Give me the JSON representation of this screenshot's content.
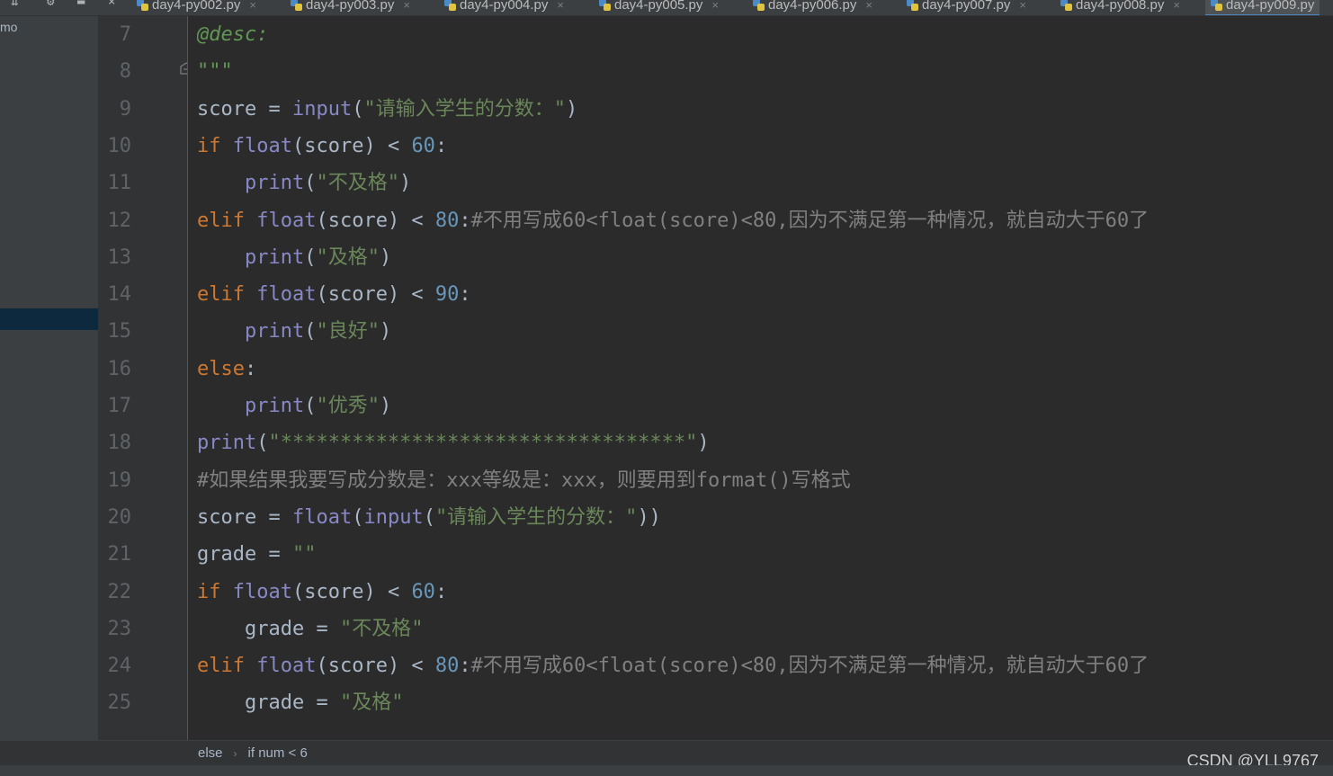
{
  "tabs": [
    {
      "label": "day4-py002.py"
    },
    {
      "label": "day4-py003.py"
    },
    {
      "label": "day4-py004.py"
    },
    {
      "label": "day4-py005.py"
    },
    {
      "label": "day4-py006.py"
    },
    {
      "label": "day4-py007.py"
    },
    {
      "label": "day4-py008.py"
    },
    {
      "label": "day4-py009.py"
    }
  ],
  "project_panel": {
    "fragment": "mo"
  },
  "line_numbers": [
    "7",
    "8",
    "9",
    "10",
    "11",
    "12",
    "13",
    "14",
    "15",
    "16",
    "17",
    "18",
    "19",
    "20",
    "21",
    "22",
    "23",
    "24",
    "25"
  ],
  "code_lines": [
    [
      {
        "t": "doc",
        "v": "@desc:"
      }
    ],
    [
      {
        "t": "doc",
        "v": "\"\"\""
      }
    ],
    [
      {
        "t": "id",
        "v": "score = "
      },
      {
        "t": "fn",
        "v": "input"
      },
      {
        "t": "id",
        "v": "("
      },
      {
        "t": "str",
        "v": "\"请输入学生的分数：\""
      },
      {
        "t": "id",
        "v": ")"
      }
    ],
    [
      {
        "t": "kw",
        "v": "if "
      },
      {
        "t": "fn",
        "v": "float"
      },
      {
        "t": "id",
        "v": "(score) < "
      },
      {
        "t": "num",
        "v": "60"
      },
      {
        "t": "id",
        "v": ":"
      }
    ],
    [
      {
        "t": "id",
        "v": "    "
      },
      {
        "t": "fn",
        "v": "print"
      },
      {
        "t": "id",
        "v": "("
      },
      {
        "t": "str",
        "v": "\"不及格\""
      },
      {
        "t": "id",
        "v": ")"
      }
    ],
    [
      {
        "t": "kw",
        "v": "elif "
      },
      {
        "t": "fn",
        "v": "float"
      },
      {
        "t": "id",
        "v": "(score) < "
      },
      {
        "t": "num",
        "v": "80"
      },
      {
        "t": "id",
        "v": ":"
      },
      {
        "t": "cm",
        "v": "#不用写成60<float(score)<80,因为不满足第一种情况，就自动大于60了"
      }
    ],
    [
      {
        "t": "id",
        "v": "    "
      },
      {
        "t": "fn",
        "v": "print"
      },
      {
        "t": "id",
        "v": "("
      },
      {
        "t": "str",
        "v": "\"及格\""
      },
      {
        "t": "id",
        "v": ")"
      }
    ],
    [
      {
        "t": "kw",
        "v": "elif "
      },
      {
        "t": "fn",
        "v": "float"
      },
      {
        "t": "id",
        "v": "(score) < "
      },
      {
        "t": "num",
        "v": "90"
      },
      {
        "t": "id",
        "v": ":"
      }
    ],
    [
      {
        "t": "id",
        "v": "    "
      },
      {
        "t": "fn",
        "v": "print"
      },
      {
        "t": "id",
        "v": "("
      },
      {
        "t": "str",
        "v": "\"良好\""
      },
      {
        "t": "id",
        "v": ")"
      }
    ],
    [
      {
        "t": "kw",
        "v": "else"
      },
      {
        "t": "id",
        "v": ":"
      }
    ],
    [
      {
        "t": "id",
        "v": "    "
      },
      {
        "t": "fn",
        "v": "print"
      },
      {
        "t": "id",
        "v": "("
      },
      {
        "t": "str",
        "v": "\"优秀\""
      },
      {
        "t": "id",
        "v": ")"
      }
    ],
    [
      {
        "t": "fn",
        "v": "print"
      },
      {
        "t": "id",
        "v": "("
      },
      {
        "t": "str",
        "v": "\"**********************************\""
      },
      {
        "t": "id",
        "v": ")"
      }
    ],
    [
      {
        "t": "cm",
        "v": "#如果结果我要写成分数是：xxx等级是：xxx，则要用到format()写格式"
      }
    ],
    [
      {
        "t": "id",
        "v": "score = "
      },
      {
        "t": "fn",
        "v": "float"
      },
      {
        "t": "id",
        "v": "("
      },
      {
        "t": "fn",
        "v": "input"
      },
      {
        "t": "id",
        "v": "("
      },
      {
        "t": "str",
        "v": "\"请输入学生的分数：\""
      },
      {
        "t": "id",
        "v": "))"
      }
    ],
    [
      {
        "t": "id",
        "v": "grade = "
      },
      {
        "t": "str",
        "v": "\"\""
      }
    ],
    [
      {
        "t": "kw",
        "v": "if "
      },
      {
        "t": "fn",
        "v": "float"
      },
      {
        "t": "id",
        "v": "(score) < "
      },
      {
        "t": "num",
        "v": "60"
      },
      {
        "t": "id",
        "v": ":"
      }
    ],
    [
      {
        "t": "id",
        "v": "    grade = "
      },
      {
        "t": "str",
        "v": "\"不及格\""
      }
    ],
    [
      {
        "t": "kw",
        "v": "elif "
      },
      {
        "t": "fn",
        "v": "float"
      },
      {
        "t": "id",
        "v": "(score) < "
      },
      {
        "t": "num",
        "v": "80"
      },
      {
        "t": "id",
        "v": ":"
      },
      {
        "t": "cm",
        "v": "#不用写成60<float(score)<80,因为不满足第一种情况，就自动大于60了"
      }
    ],
    [
      {
        "t": "id",
        "v": "    grade = "
      },
      {
        "t": "str",
        "v": "\"及格\""
      }
    ]
  ],
  "breadcrumb": {
    "item1": "else",
    "item2": "if num < 6"
  },
  "watermark": "CSDN @YLL9767",
  "colors": {
    "background": "#2b2b2b",
    "keyword": "#cc7832",
    "function": "#8888c6",
    "string": "#6a8759",
    "number": "#6897bb",
    "comment": "#808080",
    "docstring": "#629755"
  }
}
